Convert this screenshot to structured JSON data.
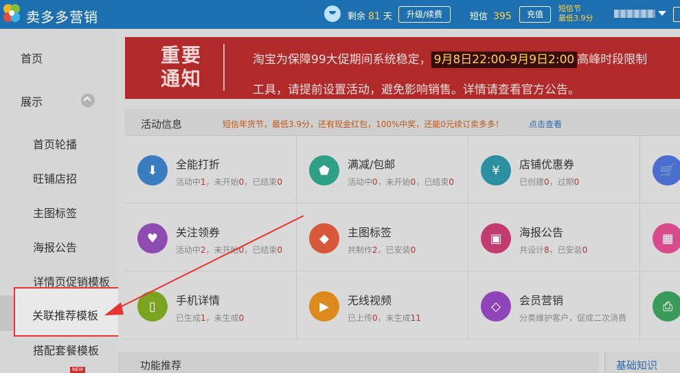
{
  "header": {
    "brand": "卖多多营销",
    "remain_label": "剩余",
    "remain_days": "81",
    "remain_unit": "天",
    "upgrade_label": "升级/续费",
    "sms_label": "短信",
    "sms_count": "395",
    "recharge_label": "充值",
    "festival_line1": "短信节",
    "festival_line2": "最低3.9分"
  },
  "sidebar": {
    "items": [
      {
        "label": "首页"
      },
      {
        "label": "展示"
      },
      {
        "label": "首页轮播"
      },
      {
        "label": "旺铺店招"
      },
      {
        "label": "主图标签"
      },
      {
        "label": "海报公告"
      },
      {
        "label": "详情页促销模板"
      },
      {
        "label": "关联推荐模板"
      },
      {
        "label": "搭配套餐模板"
      }
    ],
    "new_badge": "NEW"
  },
  "notice": {
    "title_line1": "重要",
    "title_line2": "通知",
    "line1_before": "淘宝为保障99大促期间系统稳定，",
    "line1_highlight": "9月8日22:00-9月9日2:00",
    "line1_after": "高峰时段限制",
    "line2": "工具，请提前设置活动，避免影响销售。详情请查看官方公告。"
  },
  "activity": {
    "title": "活动信息",
    "promo": "短信年货节，最低3.9分，还有现金红包，100%中奖，还能0元续订卖多多！",
    "promo_link": "点击查看",
    "cards": [
      {
        "name": "全能打折",
        "s1": "活动中",
        "v1": "1",
        "s2": "，未开始",
        "v2": "0",
        "s3": "，已结束",
        "v3": "0"
      },
      {
        "name": "满减/包邮",
        "s1": "活动中",
        "v1": "0",
        "s2": "，未开始",
        "v2": "0",
        "s3": "，已结束",
        "v3": "0"
      },
      {
        "name": "店铺优惠券",
        "s1": "已创建",
        "v1": "0",
        "s2": "，过期",
        "v2": "0",
        "s3": "",
        "v3": ""
      },
      {
        "name": "关注领券",
        "s1": "活动中",
        "v1": "2",
        "s2": "，未开始",
        "v2": "0",
        "s3": "，已结束",
        "v3": "0"
      },
      {
        "name": "主图标签",
        "s1": "共制作",
        "v1": "2",
        "s2": "，已安装",
        "v2": "0",
        "s3": "",
        "v3": ""
      },
      {
        "name": "海报公告",
        "s1": "共设计",
        "v1": "8",
        "s2": "，已安装",
        "v2": "0",
        "s3": "",
        "v3": ""
      },
      {
        "name": "手机详情",
        "s1": "已生成",
        "v1": "1",
        "s2": "，未生成",
        "v2": "0",
        "s3": "",
        "v3": ""
      },
      {
        "name": "无线视频",
        "s1": "已上传",
        "v1": "0",
        "s2": "，未生成",
        "v2": "11",
        "s3": "",
        "v3": ""
      },
      {
        "name": "会员营销",
        "s1": "分类维护客户，促成二次消费",
        "v1": "",
        "s2": "",
        "v2": "",
        "s3": "",
        "v3": ""
      }
    ]
  },
  "feature_title": "功能推荐",
  "basics_title": "基础知识",
  "colors": {
    "header_bg": "#1e6fb0",
    "notice_bg": "#b12a2a",
    "highlight_red": "#e8332f",
    "icon_blue": "#3a7dc0",
    "icon_green": "#2ea085",
    "icon_teal": "#2a8fa0",
    "icon_purple": "#8e4bb0",
    "icon_orange": "#d8583c",
    "icon_pink": "#c23c70",
    "icon_olive": "#7aa41f",
    "icon_amber": "#dd8a1c",
    "icon_violet": "#8f44b8"
  }
}
